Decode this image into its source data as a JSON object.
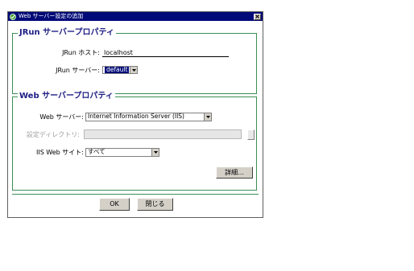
{
  "window": {
    "title": "Web サーバー設定の追加",
    "close_glyph": "×"
  },
  "jrun_group": {
    "title": "JRun サーバープロパティ",
    "host_label": "JRun ホスト:",
    "host_value": "localhost",
    "server_label": "JRun サーバー:",
    "server_value": "default"
  },
  "web_group": {
    "title": "Web サーバープロパティ",
    "web_server_label": "Web サーバー:",
    "web_server_value": "Internet Information Server (IIS)",
    "config_dir_label": "設定ディレクトリ:",
    "config_dir_value": "",
    "iis_site_label": "IIS Web サイト:",
    "iis_site_value": "すべて",
    "details_button": "詳細..."
  },
  "footer": {
    "ok_button": "OK",
    "close_button": "閉じる"
  },
  "icons": {
    "app_icon": "check-icon",
    "dropdown": "chevron-down-icon"
  },
  "colors": {
    "titlebar": "#000a78",
    "group_border": "#3a8f55",
    "group_title": "#1c1c84"
  }
}
